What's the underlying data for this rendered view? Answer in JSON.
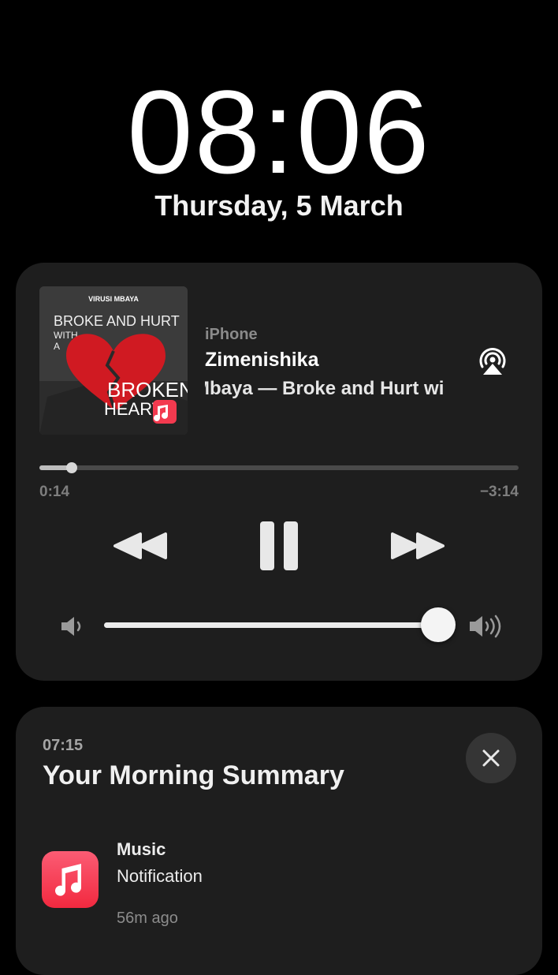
{
  "lockscreen": {
    "time": "08:06",
    "date": "Thursday, 5 March"
  },
  "now_playing": {
    "artwork": {
      "artist_text": "VIRUSI MBAYA",
      "title_text": "BROKE AND HURT WITH A BROKEN HEART"
    },
    "device": "iPhone",
    "track": "Zimenishika",
    "subtitle": "Mbaya — Broke and Hurt wi",
    "elapsed": "0:14",
    "remaining": "−3:14",
    "progress_fraction": 0.067,
    "volume_fraction": 0.99,
    "icons": {
      "airplay": "airplay-icon",
      "rewind": "rewind-icon",
      "pause": "pause-icon",
      "forward": "fast-forward-icon",
      "volume_low": "volume-low-icon",
      "volume_high": "volume-high-icon"
    }
  },
  "notification": {
    "time": "07:15",
    "title": "Your Morning Summary",
    "app_name": "Music",
    "body": "Notification",
    "ago": "56m ago",
    "icons": {
      "close": "close-icon",
      "app": "apple-music-icon"
    },
    "colors": {
      "app_icon": "#f53a50"
    }
  }
}
